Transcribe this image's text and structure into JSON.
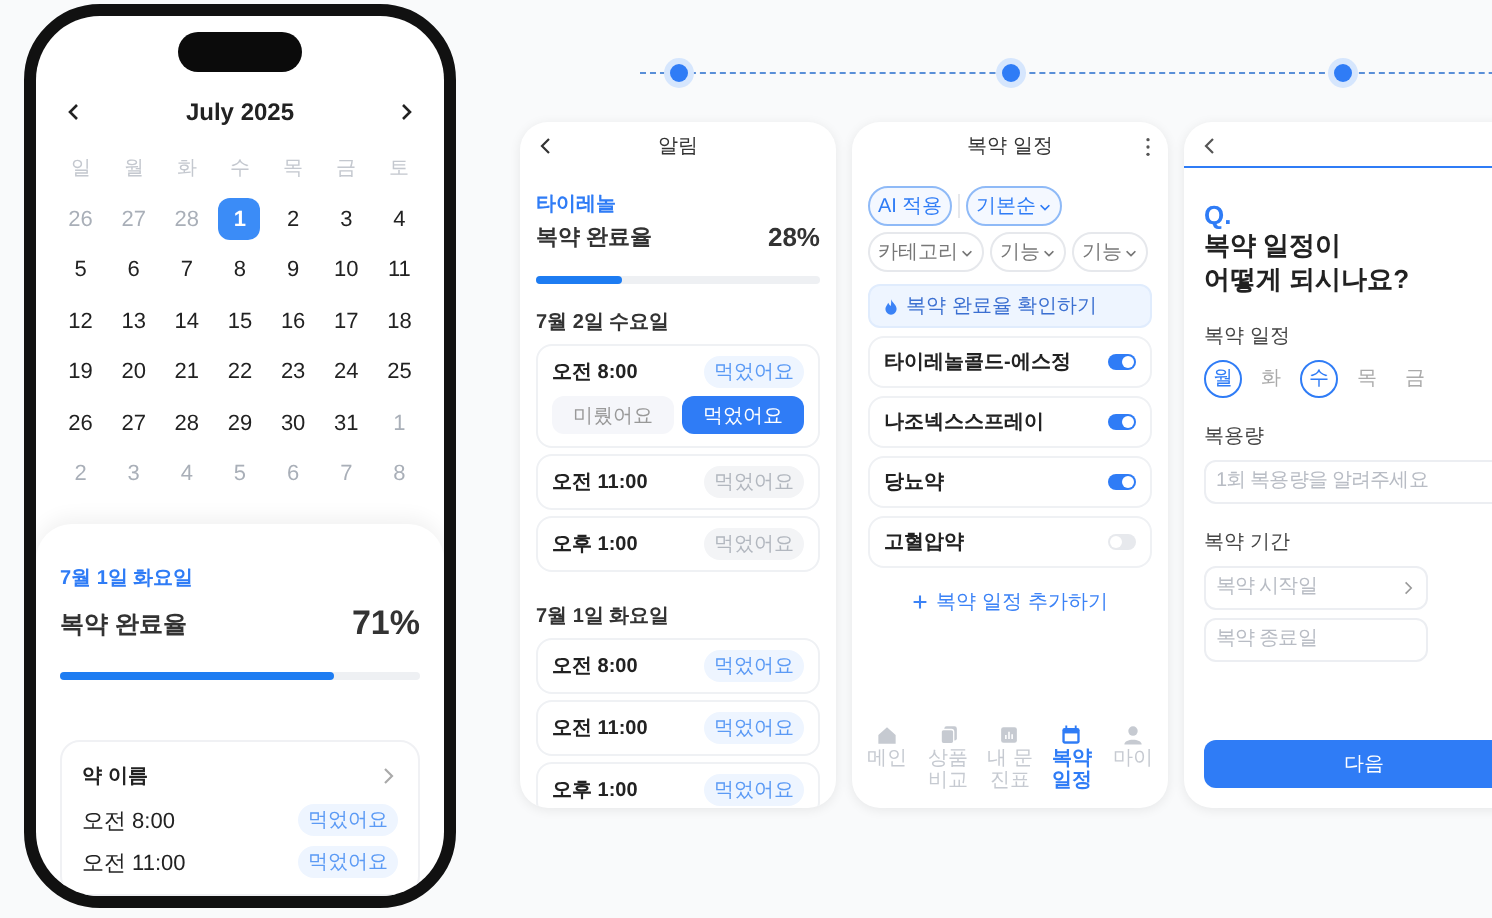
{
  "phone": {
    "calendar": {
      "month": "July 2025",
      "weekdays": [
        "일",
        "월",
        "화",
        "수",
        "목",
        "금",
        "토"
      ],
      "days": [
        {
          "day": "26",
          "muted": true,
          "selected": false
        },
        {
          "day": "27",
          "muted": true,
          "selected": false
        },
        {
          "day": "28",
          "muted": true,
          "selected": false
        },
        {
          "day": "1",
          "muted": false,
          "selected": true
        },
        {
          "day": "2",
          "muted": false,
          "selected": false
        },
        {
          "day": "3",
          "muted": false,
          "selected": false
        },
        {
          "day": "4",
          "muted": false,
          "selected": false
        },
        {
          "day": "5",
          "muted": false,
          "selected": false
        },
        {
          "day": "6",
          "muted": false,
          "selected": false
        },
        {
          "day": "7",
          "muted": false,
          "selected": false
        },
        {
          "day": "8",
          "muted": false,
          "selected": false
        },
        {
          "day": "9",
          "muted": false,
          "selected": false
        },
        {
          "day": "10",
          "muted": false,
          "selected": false
        },
        {
          "day": "11",
          "muted": false,
          "selected": false
        },
        {
          "day": "12",
          "muted": false,
          "selected": false
        },
        {
          "day": "13",
          "muted": false,
          "selected": false
        },
        {
          "day": "14",
          "muted": false,
          "selected": false
        },
        {
          "day": "15",
          "muted": false,
          "selected": false
        },
        {
          "day": "16",
          "muted": false,
          "selected": false
        },
        {
          "day": "17",
          "muted": false,
          "selected": false
        },
        {
          "day": "18",
          "muted": false,
          "selected": false
        },
        {
          "day": "19",
          "muted": false,
          "selected": false
        },
        {
          "day": "20",
          "muted": false,
          "selected": false
        },
        {
          "day": "21",
          "muted": false,
          "selected": false
        },
        {
          "day": "22",
          "muted": false,
          "selected": false
        },
        {
          "day": "23",
          "muted": false,
          "selected": false
        },
        {
          "day": "24",
          "muted": false,
          "selected": false
        },
        {
          "day": "25",
          "muted": false,
          "selected": false
        },
        {
          "day": "26",
          "muted": false,
          "selected": false
        },
        {
          "day": "27",
          "muted": false,
          "selected": false
        },
        {
          "day": "28",
          "muted": false,
          "selected": false
        },
        {
          "day": "29",
          "muted": false,
          "selected": false
        },
        {
          "day": "30",
          "muted": false,
          "selected": false
        },
        {
          "day": "31",
          "muted": false,
          "selected": false
        },
        {
          "day": "1",
          "muted": true,
          "selected": false
        },
        {
          "day": "2",
          "muted": true,
          "selected": false
        },
        {
          "day": "3",
          "muted": true,
          "selected": false
        },
        {
          "day": "4",
          "muted": true,
          "selected": false
        },
        {
          "day": "5",
          "muted": true,
          "selected": false
        },
        {
          "day": "6",
          "muted": true,
          "selected": false
        },
        {
          "day": "7",
          "muted": true,
          "selected": false
        },
        {
          "day": "8",
          "muted": true,
          "selected": false
        }
      ]
    },
    "summary": {
      "date": "7월 1일 화요일",
      "title": "복약 완료율",
      "percent": "71%",
      "level": 0.76,
      "medicine": {
        "name": "약 이름",
        "doses": [
          {
            "time": "오전 8:00",
            "badge": "먹었어요",
            "taken": true
          },
          {
            "time": "오전 11:00",
            "badge": "먹었어요",
            "taken": true
          }
        ]
      }
    }
  },
  "alarm_screen": {
    "title": "알림",
    "drug": "타이레놀",
    "rate_title": "복약 완료율",
    "percent": "28%",
    "level": 0.3,
    "days": [
      {
        "date": "7월 2일 수요일",
        "doses": [
          {
            "time": "오전 8:00",
            "badge": "먹었어요",
            "taken": true,
            "actions": [
              {
                "label": "미뤘어요",
                "selected": false
              },
              {
                "label": "먹었어요",
                "selected": true
              }
            ]
          },
          {
            "time": "오전 11:00",
            "badge": "먹었어요",
            "taken": false
          },
          {
            "time": "오후 1:00",
            "badge": "먹었어요",
            "taken": false
          }
        ]
      },
      {
        "date": "7월 1일 화요일",
        "doses": [
          {
            "time": "오전 8:00",
            "badge": "먹었어요",
            "taken": true
          },
          {
            "time": "오전 11:00",
            "badge": "먹었어요",
            "taken": true
          },
          {
            "time": "오후 1:00",
            "badge": "먹었어요",
            "taken": true
          }
        ]
      }
    ]
  },
  "schedule_screen": {
    "title": "복약 일정",
    "chips": [
      {
        "label": "AI 적용",
        "kind": "filter",
        "selected": true
      },
      {
        "label": "기본순",
        "kind": "sort",
        "selected": true
      },
      {
        "label": "카테고리",
        "kind": "sort",
        "selected": false
      },
      {
        "label": "기능",
        "kind": "sort",
        "selected": false
      },
      {
        "label": "기능",
        "kind": "sort",
        "selected": false
      }
    ],
    "banner": "복약 완료율 확인하기",
    "medicines": [
      {
        "name": "타이레놀콜드-에스정",
        "on": true
      },
      {
        "name": "나조넥스스프레이",
        "on": true
      },
      {
        "name": "당뇨약",
        "on": true
      },
      {
        "name": "고혈압약",
        "on": false
      }
    ],
    "add_label": "복약 일정 추가하기",
    "nav": [
      {
        "label": "메인",
        "kind": "home",
        "selected": false
      },
      {
        "label": "상품 비교",
        "kind": "copy",
        "selected": false
      },
      {
        "label": "내 문진표",
        "kind": "chart",
        "selected": false
      },
      {
        "label": "복약 일정",
        "kind": "calendar",
        "selected": true
      },
      {
        "label": "마이",
        "kind": "person",
        "selected": false
      }
    ]
  },
  "question_screen": {
    "q": "Q.",
    "question": [
      "복약 일정이",
      "어떻게 되시나요?"
    ],
    "schedule_label": "복약 일정",
    "weekdays": [
      {
        "label": "월",
        "selected": true
      },
      {
        "label": "화",
        "selected": false
      },
      {
        "label": "수",
        "selected": true
      },
      {
        "label": "목",
        "selected": false
      },
      {
        "label": "금",
        "selected": false
      }
    ],
    "dose_label": "복용량",
    "dose_placeholder": "1회 복용량을 알려주세요",
    "period_label": "복약 기간",
    "period_fields": [
      {
        "placeholder": "복약 시작일",
        "chevron": true
      },
      {
        "placeholder": "복약 종료일"
      }
    ],
    "next": "다음"
  }
}
